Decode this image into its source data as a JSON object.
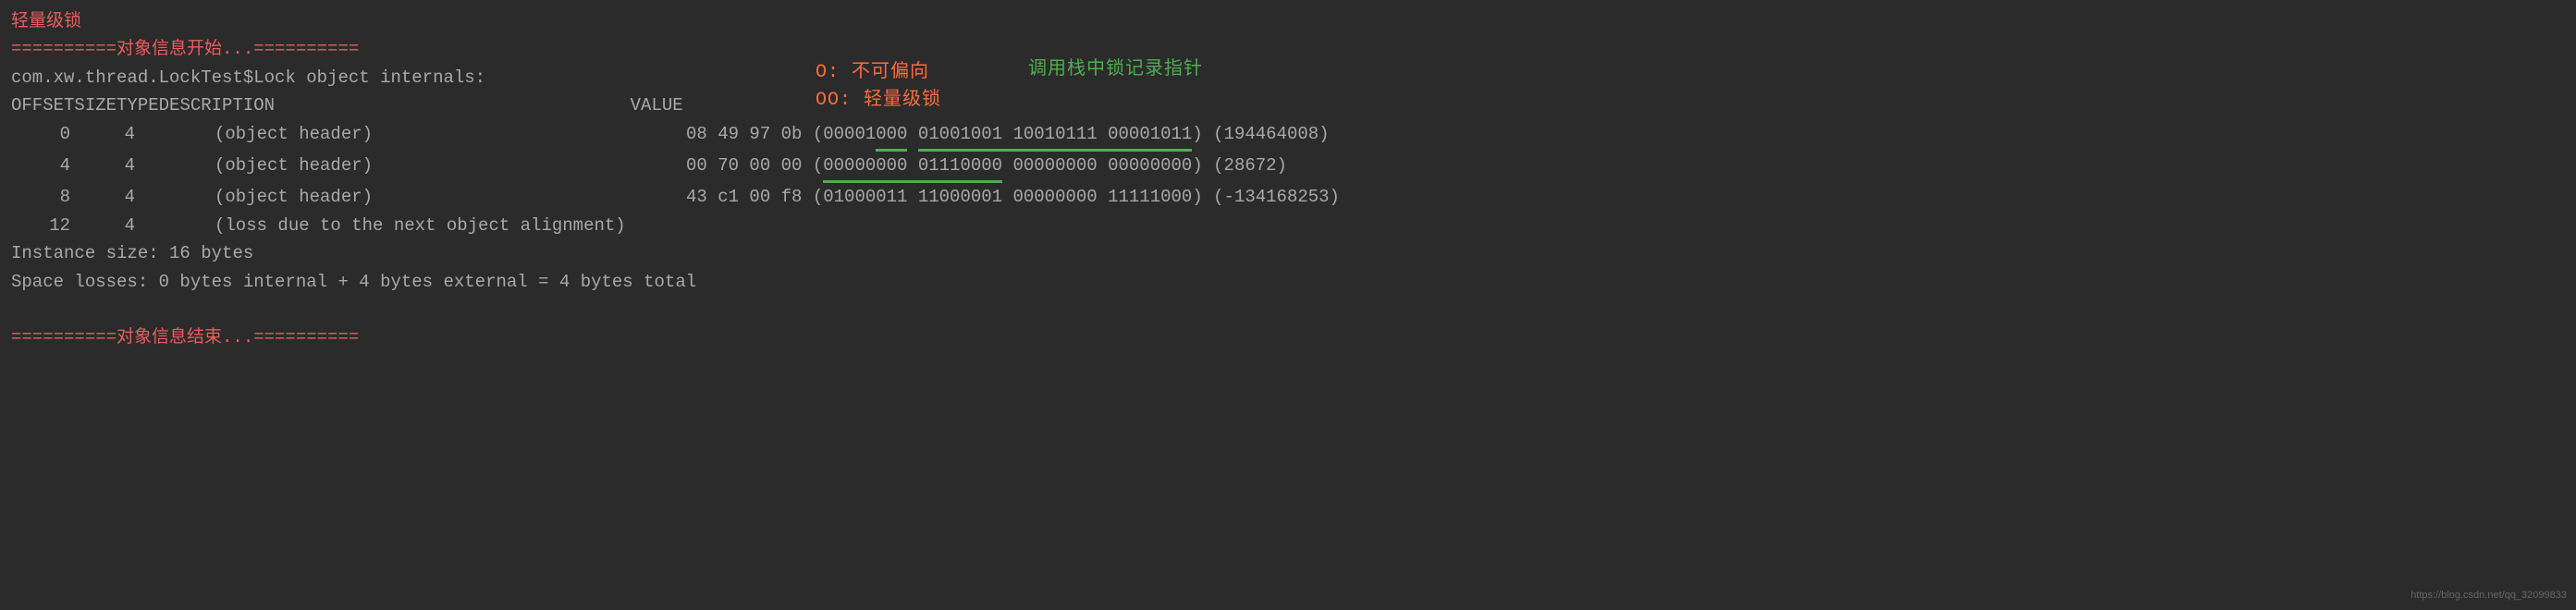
{
  "title": "轻量级锁",
  "divider_start": "==========对象信息开始...==========",
  "divider_end": "==========对象信息结束...==========",
  "class_line": "com.xw.thread.LockTest$Lock object internals:",
  "header": {
    "offset": " OFFSET",
    "size": "SIZE",
    "type": "TYPE",
    "desc": "DESCRIPTION",
    "value": "VALUE"
  },
  "annot": {
    "line1": "O:  不可偏向",
    "line2": "OO: 轻量级锁",
    "green": "调用栈中锁记录指针"
  },
  "rows": [
    {
      "offset": "0",
      "size": "4",
      "type": "",
      "desc": "(object header)",
      "hex": "08 49 97 0b",
      "bin_pre": "00001",
      "bin_u1": "000",
      "bin_space1": " ",
      "bin_u2": "01001001 10010111 00001011",
      "bin_post": "",
      "dec": "(194464008)"
    },
    {
      "offset": "4",
      "size": "4",
      "type": "",
      "desc": "(object header)",
      "hex": "00 70 00 00",
      "bin_pre": "",
      "bin_u1": "00000000 01110000",
      "bin_space1": " ",
      "bin_u2": "",
      "bin_post": "00000000 00000000",
      "dec": "(28672)"
    },
    {
      "offset": "8",
      "size": "4",
      "type": "",
      "desc": "(object header)",
      "hex": "43 c1 00 f8",
      "bin_pre": "01000011 11000001 00000000 11111000",
      "bin_u1": "",
      "bin_space1": "",
      "bin_u2": "",
      "bin_post": "",
      "dec": "(-134168253)"
    },
    {
      "offset": "12",
      "size": "4",
      "type": "",
      "desc": "(loss due to the next object alignment)",
      "hex": "",
      "bin_pre": "",
      "bin_u1": "",
      "bin_space1": "",
      "bin_u2": "",
      "bin_post": "",
      "dec": ""
    }
  ],
  "instance_size": "Instance size: 16 bytes",
  "space_losses": "Space losses: 0 bytes internal + 4 bytes external = 4 bytes total",
  "watermark": "https://blog.csdn.net/qq_32099833"
}
